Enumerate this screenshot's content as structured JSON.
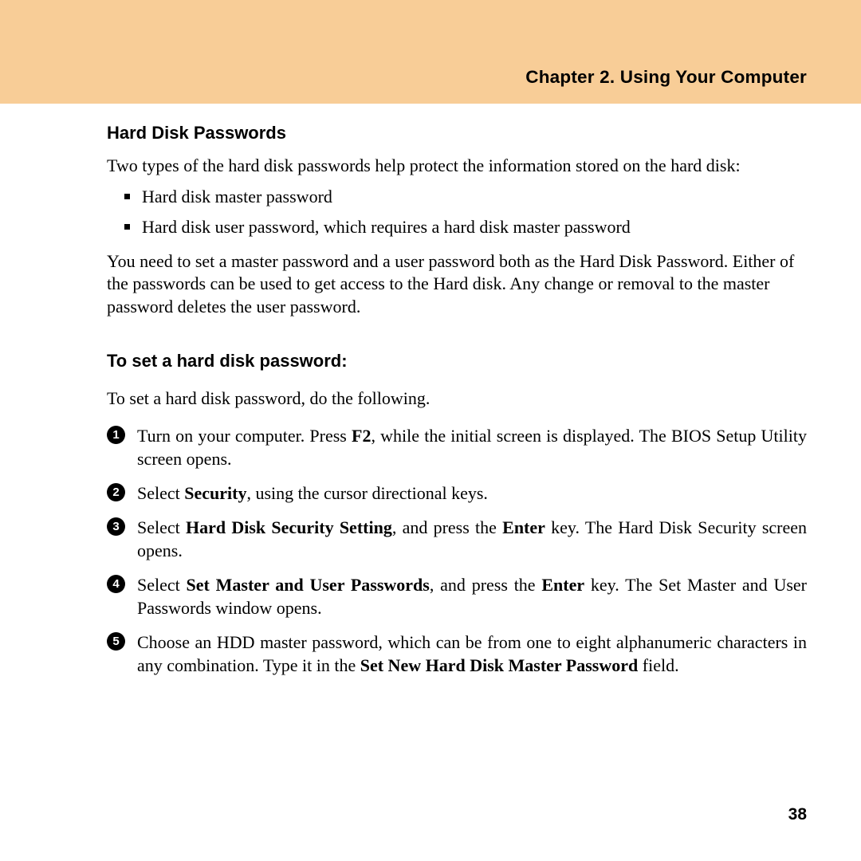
{
  "header": {
    "chapter_title": "Chapter 2. Using Your Computer"
  },
  "section1": {
    "heading": "Hard Disk Passwords",
    "intro": "Two types of the hard disk passwords help protect the information stored on the hard disk:",
    "bullets": [
      "Hard disk master password",
      "Hard disk user password, which requires a hard disk master password"
    ],
    "after": "You need to set a master password and a user password both as the Hard Disk Password. Either of the passwords can be used to get access to the Hard disk. Any change or removal to the master password deletes the user password."
  },
  "section2": {
    "heading": "To set a hard disk password:",
    "intro": "To set a hard disk password, do the following.",
    "steps": [
      {
        "pre": "Turn on your computer. Press ",
        "b1": "F2",
        "post": ", while the initial screen is displayed. The BIOS Setup Utility screen opens."
      },
      {
        "pre": "Select ",
        "b1": "Security",
        "post": ", using the cursor directional keys."
      },
      {
        "pre": "Select ",
        "b1": "Hard Disk Security Setting",
        "mid": ", and press the ",
        "b2": "Enter",
        "post": " key. The Hard Disk Security screen opens."
      },
      {
        "pre": "Select ",
        "b1": "Set Master and User Passwords",
        "mid": ", and press the ",
        "b2": "Enter",
        "post": " key. The Set Master and User Passwords window opens."
      },
      {
        "pre": "Choose an HDD master password, which can be from one to eight alphanumeric characters in any combination. Type it in the ",
        "b1": "Set New Hard Disk Master Password",
        "post": " field."
      }
    ]
  },
  "page_number": "38"
}
